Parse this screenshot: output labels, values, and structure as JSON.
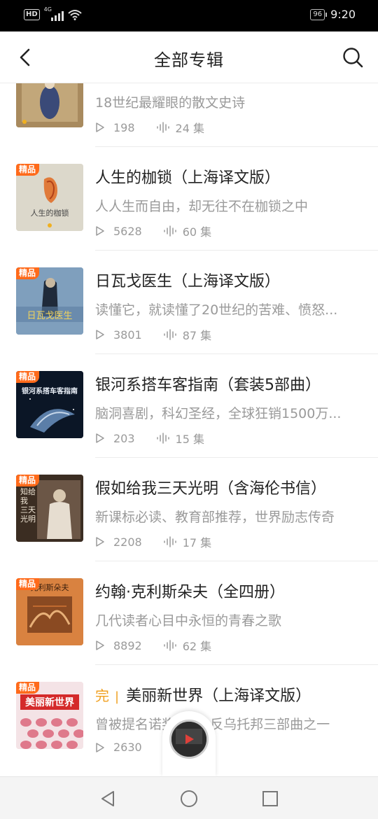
{
  "status_bar": {
    "hd": "HD",
    "network": "4G",
    "battery": "96",
    "time": "9:20"
  },
  "header": {
    "title": "全部专辑"
  },
  "accent_color": "#ff6a1a",
  "items": [
    {
      "title": "",
      "desc": "18世纪最耀眼的散文史诗",
      "plays": "198",
      "episodes": "24 集",
      "badge": "",
      "complete": ""
    },
    {
      "title": "人生的枷锁（上海译文版）",
      "desc": "人人生而自由，却无往不在枷锁之中",
      "plays": "5628",
      "episodes": "60 集",
      "badge": "精品",
      "complete": ""
    },
    {
      "title": "日瓦戈医生（上海译文版）",
      "desc": "读懂它，就读懂了20世纪的苦难、愤怒...",
      "plays": "3801",
      "episodes": "87 集",
      "badge": "精品",
      "complete": ""
    },
    {
      "title": "银河系搭车客指南（套装5部曲）",
      "desc": "脑洞喜剧，科幻圣经，全球狂销1500万...",
      "plays": "203",
      "episodes": "15 集",
      "badge": "精品",
      "complete": ""
    },
    {
      "title": "假如给我三天光明（含海伦书信）",
      "desc": "新课标必读、教育部推荐，世界励志传奇",
      "plays": "2208",
      "episodes": "17 集",
      "badge": "精品",
      "complete": ""
    },
    {
      "title": "约翰·克利斯朵夫（全四册）",
      "desc": "几代读者心目中永恒的青春之歌",
      "plays": "8892",
      "episodes": "62 集",
      "badge": "精品",
      "complete": ""
    },
    {
      "title": "美丽新世界（上海译文版）",
      "desc": "曾被提名诺奖7次，反乌托邦三部曲之一",
      "plays": "2630",
      "episodes": "",
      "badge": "精品",
      "complete": "完",
      "complete_sep": "|"
    }
  ],
  "covers": [
    {
      "text": ""
    },
    {
      "text": "人生的枷锁"
    },
    {
      "text": "日瓦戈医生"
    },
    {
      "text": "银河系搭车客指南"
    },
    {
      "text": "知给我 三天光明"
    },
    {
      "text": "克利斯朵夫"
    },
    {
      "text": "美丽新世界"
    }
  ]
}
